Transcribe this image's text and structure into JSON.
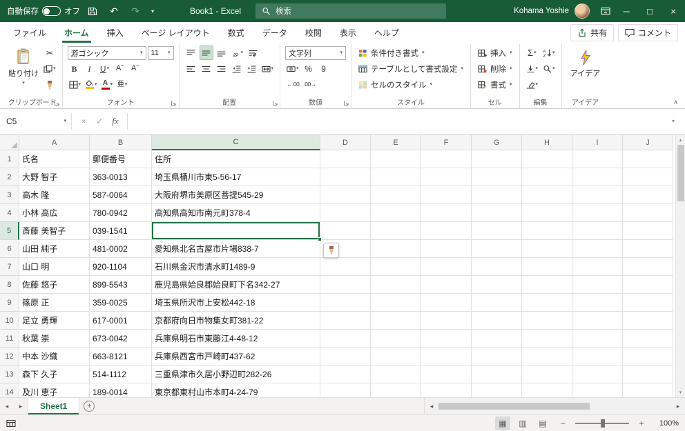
{
  "titlebar": {
    "autosave": "自動保存",
    "autosave_state": "オフ",
    "title": "Book1 - Excel",
    "search": "検索",
    "user": "Kohama Yoshie"
  },
  "tabs": [
    {
      "label": "ファイル",
      "active": false
    },
    {
      "label": "ホーム",
      "active": true
    },
    {
      "label": "挿入",
      "active": false
    },
    {
      "label": "ページ レイアウト",
      "active": false
    },
    {
      "label": "数式",
      "active": false
    },
    {
      "label": "データ",
      "active": false
    },
    {
      "label": "校閲",
      "active": false
    },
    {
      "label": "表示",
      "active": false
    },
    {
      "label": "ヘルプ",
      "active": false
    }
  ],
  "tab_actions": {
    "share": "共有",
    "comments": "コメント"
  },
  "ribbon": {
    "clipboard": {
      "group_label": "クリップボード",
      "paste_label": "貼り付け",
      "small_buttons": [
        {
          "id": "cut",
          "glyph": "✂"
        },
        {
          "id": "copy",
          "caret": true
        },
        {
          "id": "format-painter"
        }
      ]
    },
    "font": {
      "group_label": "フォント",
      "font_name": "游ゴシック",
      "font_size": "11",
      "row2": [
        {
          "id": "bold",
          "glyph": "B"
        },
        {
          "id": "italic",
          "glyph": "I"
        },
        {
          "id": "underline",
          "glyph": "U",
          "caret": true
        },
        {
          "id": "increase-font-size",
          "glyph": "Aˆ"
        },
        {
          "id": "decrease-font-size",
          "glyph": "Aˇ"
        }
      ],
      "row3": [
        {
          "id": "borders",
          "caret": true
        },
        {
          "id": "fill-color",
          "caret": true,
          "bar": "#FFC000"
        },
        {
          "id": "font-color",
          "glyph": "A",
          "caret": true,
          "bar": "#C00000"
        },
        {
          "id": "phonetic-guide",
          "glyph": "亜",
          "caret": true
        }
      ]
    },
    "alignment": {
      "group_label": "配置",
      "row1": [
        {
          "id": "align-top"
        },
        {
          "id": "align-middle",
          "active": true
        },
        {
          "id": "align-bottom"
        },
        {
          "id": "orientation",
          "caret": true
        },
        {
          "id": "wrap-text"
        }
      ],
      "row2": [
        {
          "id": "align-left"
        },
        {
          "id": "align-center"
        },
        {
          "id": "align-right"
        },
        {
          "id": "decrease-indent"
        },
        {
          "id": "increase-indent"
        },
        {
          "id": "merge-center",
          "caret": true
        }
      ]
    },
    "number": {
      "group_label": "数値",
      "format": "文字列",
      "row2": [
        {
          "id": "currency-format",
          "caret": true
        },
        {
          "id": "percent-style",
          "glyph": "%"
        },
        {
          "id": "comma-style",
          "glyph": "9"
        }
      ],
      "row3": [
        {
          "id": "increase-decimal",
          "glyph": "←.00",
          "cls": "tiny"
        },
        {
          "id": "decrease-decimal",
          "glyph": ".00→",
          "cls": "tiny"
        }
      ]
    },
    "styles": {
      "group_label": "スタイル",
      "items": [
        {
          "id": "conditional-formatting",
          "label": "条件付き書式"
        },
        {
          "id": "format-as-table",
          "label": "テーブルとして書式設定"
        },
        {
          "id": "cell-styles",
          "label": "セルのスタイル"
        }
      ]
    },
    "cells": {
      "group_label": "セル",
      "items": [
        {
          "id": "insert-cells",
          "label": "挿入"
        },
        {
          "id": "delete-cells",
          "label": "削除"
        },
        {
          "id": "format-cells",
          "label": "書式"
        }
      ]
    },
    "editing": {
      "group_label": "編集",
      "buttons": [
        {
          "id": "autosum",
          "glyph": "Σ",
          "caret": true
        },
        {
          "id": "sort-filter",
          "caret": true
        },
        {
          "id": "fill",
          "caret": true
        },
        {
          "id": "find-select",
          "caret": true
        },
        {
          "id": "clear",
          "caret": true
        }
      ]
    },
    "ideas": {
      "group_label": "アイデア",
      "label": "アイデア"
    }
  },
  "formula_bar": {
    "name_box": "C5",
    "formula": "",
    "fx_label": "fx"
  },
  "grid": {
    "columns": [
      "A",
      "B",
      "C",
      "D",
      "E",
      "F",
      "G",
      "H",
      "I",
      "J"
    ],
    "selected_cell": "C5",
    "selected_column": "C",
    "selected_row": 5,
    "rows": [
      {
        "n": 1,
        "cells": {
          "A": "氏名",
          "B": "郵便番号",
          "C": "住所"
        }
      },
      {
        "n": 2,
        "cells": {
          "A": "大野 智子",
          "B": "363-0013",
          "C": "埼玉県桶川市東5-56-17"
        }
      },
      {
        "n": 3,
        "cells": {
          "A": "高木 隆",
          "B": "587-0064",
          "C": "大阪府堺市美原区菩提545-29"
        }
      },
      {
        "n": 4,
        "cells": {
          "A": "小林 高広",
          "B": "780-0942",
          "C": "高知県高知市南元町378-4"
        }
      },
      {
        "n": 5,
        "cells": {
          "A": "斎藤 美智子",
          "B": "039-1541",
          "C": ""
        }
      },
      {
        "n": 6,
        "cells": {
          "A": "山田 純子",
          "B": "481-0002",
          "C": "愛知県北名古屋市片場838-7"
        }
      },
      {
        "n": 7,
        "cells": {
          "A": "山口 明",
          "B": "920-1104",
          "C": "石川県金沢市清水町1489-9"
        }
      },
      {
        "n": 8,
        "cells": {
          "A": "佐藤 悠子",
          "B": "899-5543",
          "C": "鹿児島県姶良郡姶良町下名342-27"
        }
      },
      {
        "n": 9,
        "cells": {
          "A": "篠原 正",
          "B": "359-0025",
          "C": "埼玉県所沢市上安松442-18"
        }
      },
      {
        "n": 10,
        "cells": {
          "A": "足立 勇輝",
          "B": "617-0001",
          "C": "京都府向日市物集女町381-22"
        }
      },
      {
        "n": 11,
        "cells": {
          "A": "秋葉 崇",
          "B": "673-0042",
          "C": "兵庫県明石市東藤江4-48-12"
        }
      },
      {
        "n": 12,
        "cells": {
          "A": "中本 沙織",
          "B": "663-8121",
          "C": "兵庫県西宮市戸崎町437-62"
        }
      },
      {
        "n": 13,
        "cells": {
          "A": "森下 久子",
          "B": "514-1112",
          "C": "三重県津市久居小野辺町282-26"
        }
      },
      {
        "n": 14,
        "cells": {
          "A": "及川 恵子",
          "B": "189-0014",
          "C": "東京都東村山市本町4-24-79"
        }
      }
    ]
  },
  "sheetbar": {
    "tabs": [
      {
        "label": "Sheet1",
        "active": true
      }
    ]
  },
  "statusbar": {
    "zoom_level": "100%"
  }
}
